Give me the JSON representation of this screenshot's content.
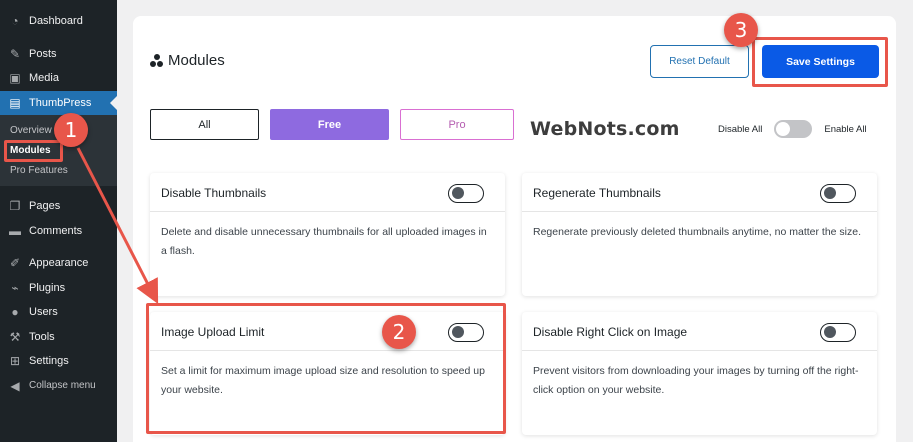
{
  "sidebar": {
    "items": [
      {
        "label": "Dashboard",
        "icon": "dashboard-icon"
      },
      {
        "label": "Posts",
        "icon": "pin-icon"
      },
      {
        "label": "Media",
        "icon": "media-icon"
      },
      {
        "label": "ThumbPress",
        "icon": "thumbpress-icon"
      },
      {
        "label": "Pages",
        "icon": "pages-icon"
      },
      {
        "label": "Comments",
        "icon": "comments-icon"
      },
      {
        "label": "Appearance",
        "icon": "appearance-icon"
      },
      {
        "label": "Plugins",
        "icon": "plugins-icon"
      },
      {
        "label": "Users",
        "icon": "users-icon"
      },
      {
        "label": "Tools",
        "icon": "tools-icon"
      },
      {
        "label": "Settings",
        "icon": "settings-icon"
      },
      {
        "label": "Collapse menu",
        "icon": "collapse-icon"
      }
    ],
    "submenu": [
      "Overview",
      "Modules",
      "Pro Features"
    ]
  },
  "header": {
    "title": "Modules",
    "reset_label": "Reset Default",
    "save_label": "Save Settings"
  },
  "filters": {
    "all": "All",
    "free": "Free",
    "pro": "Pro"
  },
  "watermark": "WebNots.com",
  "bulk": {
    "disable": "Disable All",
    "enable": "Enable All"
  },
  "cards": [
    {
      "title": "Disable Thumbnails",
      "desc": "Delete and disable unnecessary thumbnails for all uploaded images in a flash."
    },
    {
      "title": "Regenerate Thumbnails",
      "desc": "Regenerate previously deleted thumbnails anytime, no matter the size."
    },
    {
      "title": "Image Upload Limit",
      "desc": "Set a limit for maximum image upload size and resolution to speed up your website."
    },
    {
      "title": "Disable Right Click on Image",
      "desc": "Prevent visitors from downloading your images by turning off the right-click option on your website."
    }
  ],
  "annotations": {
    "one": "1",
    "two": "2",
    "three": "3"
  },
  "colors": {
    "accent": "#2271b1",
    "save": "#0a5ae6",
    "free": "#8e6ae0",
    "annotation": "#e8564a"
  }
}
